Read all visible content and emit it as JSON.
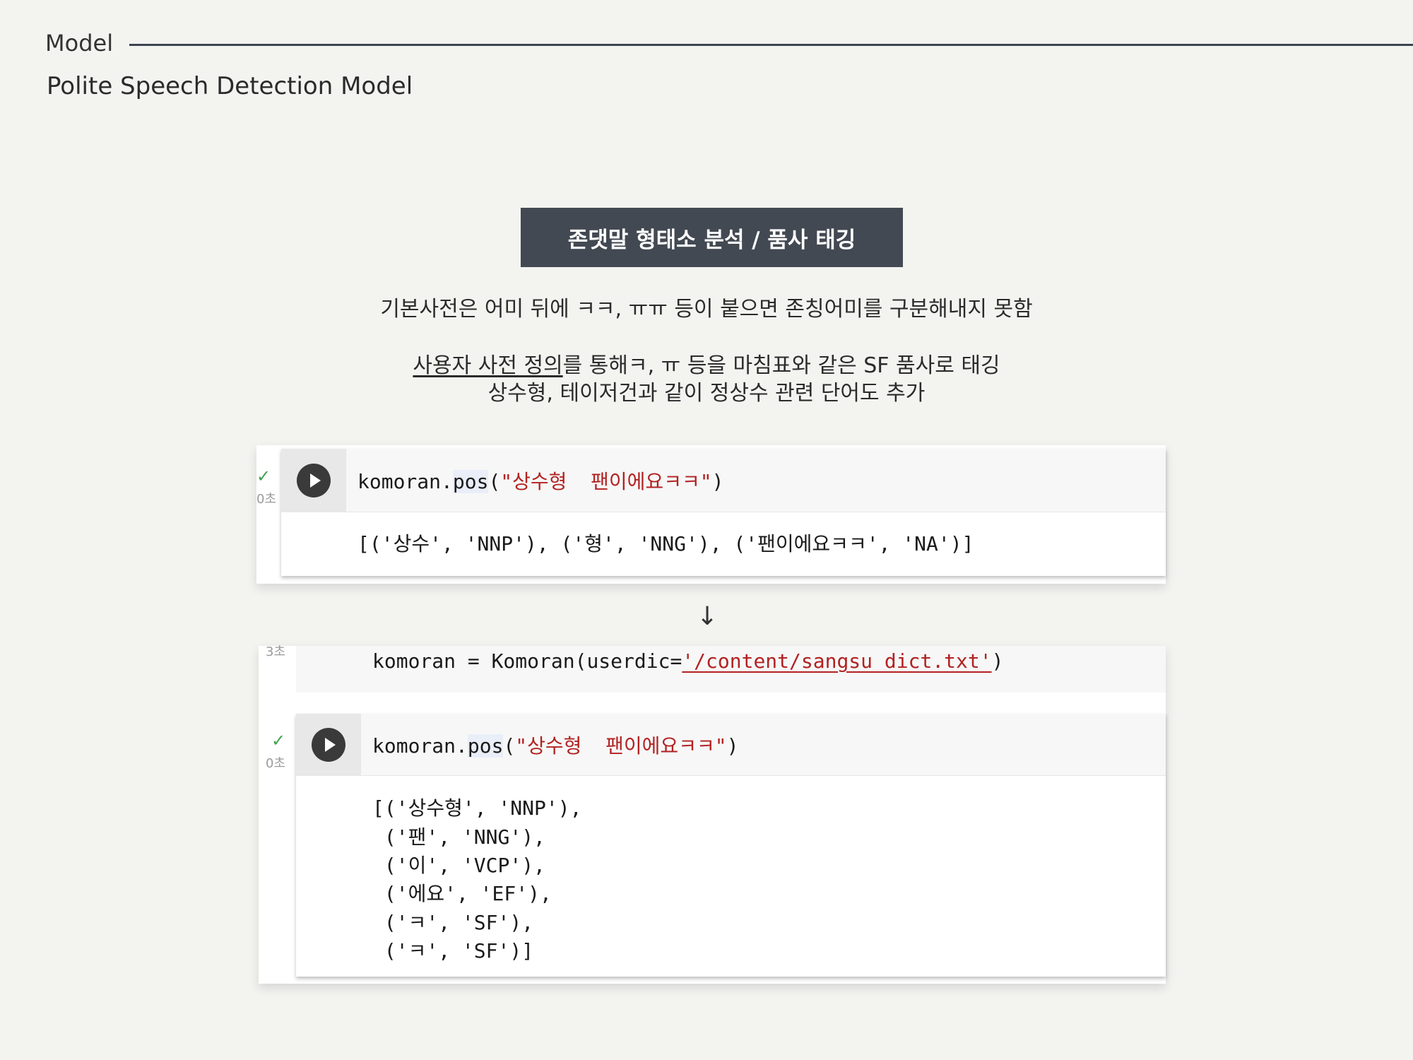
{
  "header": {
    "section": "Model",
    "subtitle": "Polite Speech Detection Model"
  },
  "title_box": "존댓말 형태소 분석 / 품사 태깅",
  "description": {
    "line1": "기본사전은 어미 뒤에 ㅋㅋ, ㅠㅠ 등이 붙으면 존칭어미를 구분해내지 못함",
    "line2_underlined": "사용자 사전 정의",
    "line2_rest": "를 통해ㅋ, ㅠ 등을 마침표와 같은 SF 품사로 태깅",
    "line3": "상수형, 테이저건과 같이 정상수 관련 단어도 추가"
  },
  "cell1": {
    "check": "✓",
    "time": "0초",
    "code_obj": "komoran.",
    "code_fn": "pos",
    "code_open": "(",
    "code_str": "\"상수형  팬이에요ㅋㅋ\"",
    "code_close": ")",
    "output": "[('상수', 'NNP'), ('형', 'NNG'), ('팬이에요ㅋㅋ', 'NA')]"
  },
  "arrow": "↓",
  "cell2": {
    "prev_time": "3초",
    "assign_code_a": "komoran = ",
    "assign_code_b": "Komoran(userdic=",
    "assign_str": "'/content/sangsu_dict.txt'",
    "assign_close": ")",
    "check": "✓",
    "time": "0초",
    "code_obj": "komoran.",
    "code_fn": "pos",
    "code_open": "(",
    "code_str": "\"상수형  팬이에요ㅋㅋ\"",
    "code_close": ")",
    "output_lines": [
      "[('상수형', 'NNP'),",
      " ('팬', 'NNG'),",
      " ('이', 'VCP'),",
      " ('에요', 'EF'),",
      " ('ㅋ', 'SF'),",
      " ('ㅋ', 'SF')]"
    ]
  }
}
